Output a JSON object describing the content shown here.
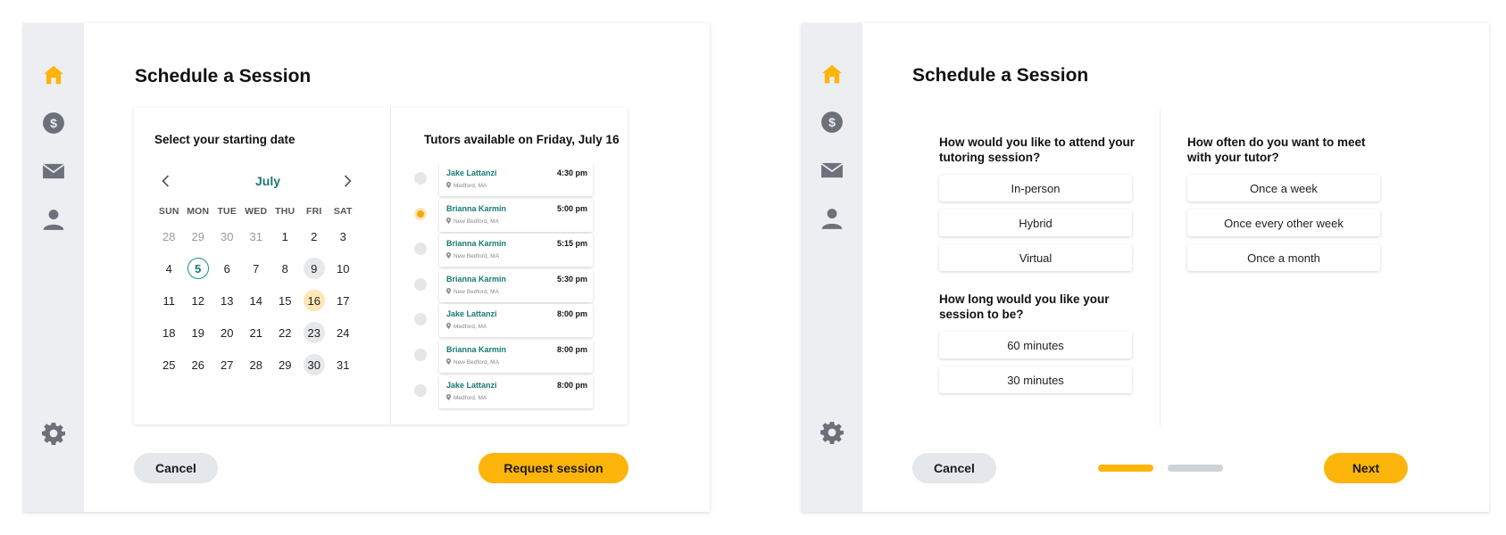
{
  "colors": {
    "accent": "#fdb40b",
    "teal": "#177a73",
    "sidebar_bg": "#eceef1",
    "icon_grey": "#6b7079"
  },
  "sidebar": {
    "icons": [
      "home-icon",
      "dollar-icon",
      "mail-icon",
      "user-icon",
      "gear-icon"
    ]
  },
  "left": {
    "title": "Schedule a Session",
    "calendar": {
      "heading": "Select your starting date",
      "month": "July",
      "days_of_week": [
        "SUN",
        "MON",
        "TUE",
        "WED",
        "THU",
        "FRI",
        "SAT"
      ],
      "weeks": [
        [
          "28",
          "29",
          "30",
          "31",
          "1",
          "2",
          "3"
        ],
        [
          "4",
          "5",
          "6",
          "7",
          "8",
          "9",
          "10"
        ],
        [
          "11",
          "12",
          "13",
          "14",
          "15",
          "16",
          "17"
        ],
        [
          "18",
          "19",
          "20",
          "21",
          "22",
          "23",
          "24"
        ],
        [
          "25",
          "26",
          "27",
          "28",
          "29",
          "30",
          "31"
        ]
      ],
      "muted_days": [
        "28",
        "29",
        "30",
        "31"
      ],
      "today": "5",
      "selected": "16",
      "available": [
        "9",
        "23",
        "30"
      ]
    },
    "tutors": {
      "heading": "Tutors available on Friday, July 16",
      "selected_index": 1,
      "slots": [
        {
          "name": "Jake Lattanzi",
          "time": "4:30 pm",
          "location": "Medford, MA"
        },
        {
          "name": "Brianna Karmin",
          "time": "5:00 pm",
          "location": "New Bedford, MA"
        },
        {
          "name": "Brianna Karmin",
          "time": "5:15 pm",
          "location": "New Bedford, MA"
        },
        {
          "name": "Brianna Karmin",
          "time": "5:30 pm",
          "location": "New Bedford, MA"
        },
        {
          "name": "Jake Lattanzi",
          "time": "8:00 pm",
          "location": "Medford, MA"
        },
        {
          "name": "Brianna Karmin",
          "time": "8:00 pm",
          "location": "New Bedford, MA"
        },
        {
          "name": "Jake Lattanzi",
          "time": "8:00 pm",
          "location": "Medford, MA"
        }
      ]
    },
    "cancel_label": "Cancel",
    "submit_label": "Request session"
  },
  "right": {
    "title": "Schedule a Session",
    "attend": {
      "question": "How would you like to attend your tutoring session?",
      "options": [
        "In-person",
        "Hybrid",
        "Virtual"
      ]
    },
    "length": {
      "question": "How long would you like your session to be?",
      "options": [
        "60 minutes",
        "30 minutes"
      ]
    },
    "frequency": {
      "question": "How often do you want to meet with your tutor?",
      "options": [
        "Once a week",
        "Once every other week",
        "Once a month"
      ]
    },
    "progress": {
      "current_step": 1,
      "total_steps": 2
    },
    "cancel_label": "Cancel",
    "next_label": "Next"
  }
}
